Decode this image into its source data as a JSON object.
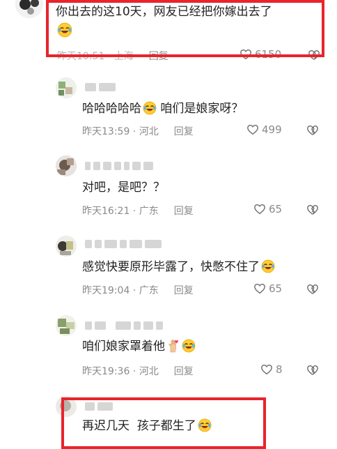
{
  "comments": [
    {
      "text": "你出去的这10天，网友已经把你嫁出去了",
      "meta": "昨天10:51 · 上海",
      "reply": "回复",
      "likes": "6150"
    },
    {
      "text": "哈哈哈哈哈",
      "text_after": " 咱们是娘家呀？",
      "meta": "昨天13:59 · 河北",
      "reply": "回复",
      "likes": "499"
    },
    {
      "text": "对吧，是吧？？",
      "meta": "昨天16:21 · 广东",
      "reply": "回复",
      "likes": "65"
    },
    {
      "text": "感觉快要原形毕露了，快憋不住了",
      "meta": "昨天19:04 · 广东",
      "reply": "回复",
      "likes": "65"
    },
    {
      "text": "咱们娘家罩着他",
      "meta": "昨天19:36 · 河北",
      "reply": "回复",
      "likes": "8"
    },
    {
      "text": "再迟几天  孩子都生了"
    }
  ],
  "colors": {
    "highlight_box": "#e8242c",
    "meta_text": "#8a8a8a"
  }
}
